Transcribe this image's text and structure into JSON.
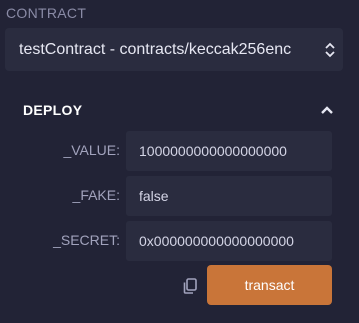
{
  "section": {
    "label": "CONTRACT"
  },
  "contract_select": {
    "value": "testContract - contracts/keccak256enc"
  },
  "deploy": {
    "title": "DEPLOY",
    "params": [
      {
        "label": "_VALUE:",
        "value": "1000000000000000000"
      },
      {
        "label": "_FAKE:",
        "value": "false"
      },
      {
        "label": "_SECRET:",
        "value": "0x000000000000000000"
      }
    ],
    "transact_label": "transact"
  },
  "icons": {
    "select_arrows": "chevron-up-down-icon",
    "collapse": "chevron-up-icon",
    "copy": "copy-icon"
  },
  "colors": {
    "background": "#222336",
    "field": "#2a2c3f",
    "accent": "#c97539"
  }
}
